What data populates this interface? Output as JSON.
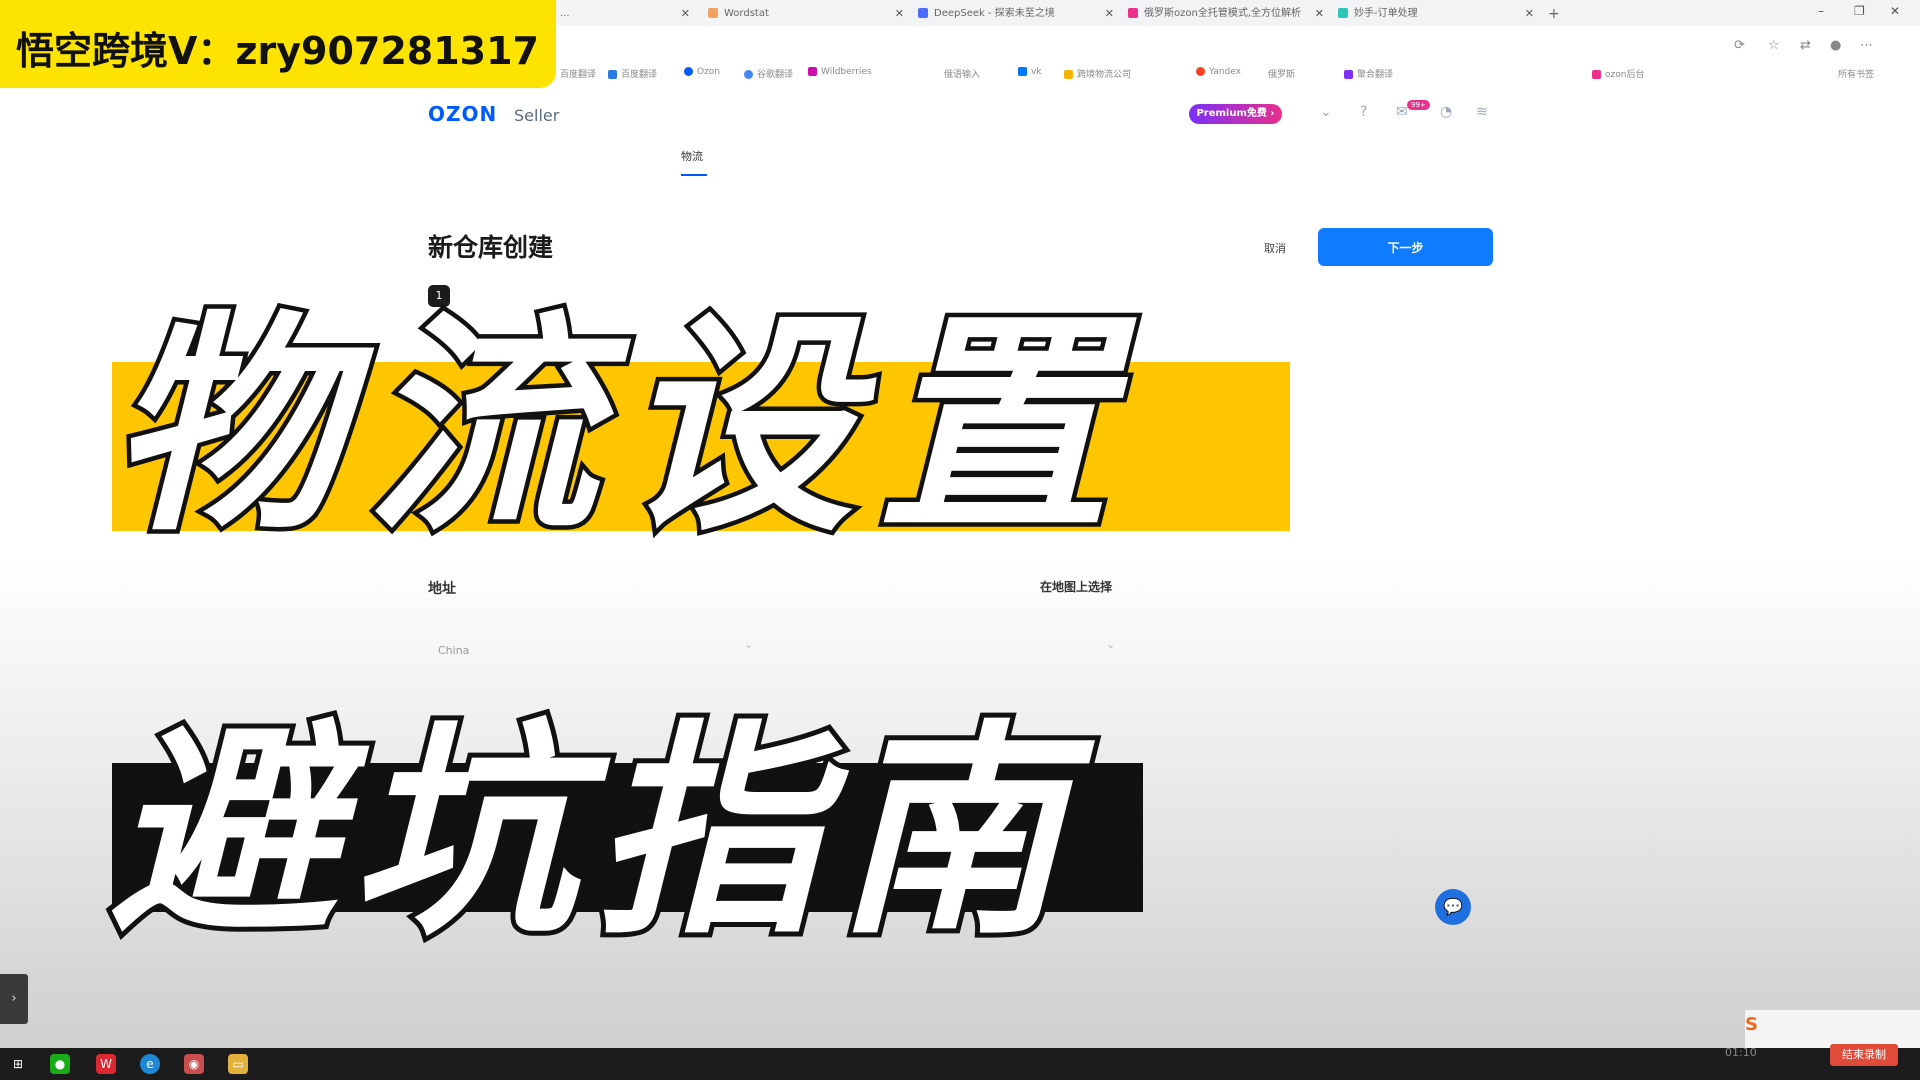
{
  "browser": {
    "tabs": [
      {
        "label": "...",
        "color": "#cccccc"
      },
      {
        "label": "Wordstat",
        "color": "#f4a261"
      },
      {
        "label": "DeepSeek - 探索未至之境",
        "color": "#4d6bfe"
      },
      {
        "label": "俄罗斯ozon全托管模式,全方位解析",
        "color": "#e8308c"
      },
      {
        "label": "妙手-订单处理",
        "color": "#2ec4b6"
      }
    ],
    "new_tab": "+",
    "window_controls": {
      "minimize": "–",
      "restore": "❐",
      "close": "✕"
    },
    "bookmarks": [
      {
        "label": "百度翻译",
        "color": "#2a7ae2"
      },
      {
        "label": "Ozon",
        "color": "#005bff"
      },
      {
        "label": "谷歌翻译",
        "color": "#4285f4"
      },
      {
        "label": "Wildberries",
        "color": "#cb11ab"
      },
      {
        "label": "俄语输入",
        "color": "#888888"
      },
      {
        "label": "vk",
        "color": "#0077ff"
      },
      {
        "label": "跨境物流公司",
        "color": "#f4b400"
      },
      {
        "label": "Yandex",
        "color": "#fc3f1d"
      },
      {
        "label": "俄罗斯",
        "color": "#888888"
      },
      {
        "label": "聚合翻译",
        "color": "#7b2ff7"
      },
      {
        "label": "ozon后台",
        "color": "#e8308c"
      }
    ],
    "bookmarks_folder": "所有书签"
  },
  "header": {
    "logo": "OZON",
    "seller": "Seller",
    "premium_label": "Premium免费 ›",
    "notification_badge": "99+",
    "nav_active": "物流"
  },
  "form": {
    "title": "新仓库创建",
    "step_number": "1",
    "cancel_label": "取消",
    "next_label": "下一步",
    "address_label": "地址",
    "map_label": "在地图上选择",
    "country_value": "China"
  },
  "overlay": {
    "watermark": "悟空跨境V：zry907281317",
    "title_line1": "物流设置",
    "title_line2": "避坑指南",
    "colors": {
      "watermark_bg": "#fce300",
      "band_yellow": "#fdc600",
      "band_black": "#111111"
    }
  },
  "taskbar": {
    "icons": [
      "start-icon",
      "wechat-icon",
      "wps-icon",
      "edge-icon",
      "app-icon",
      "explorer-icon"
    ],
    "end_recording_label": "结束录制",
    "clock": "01:10"
  }
}
